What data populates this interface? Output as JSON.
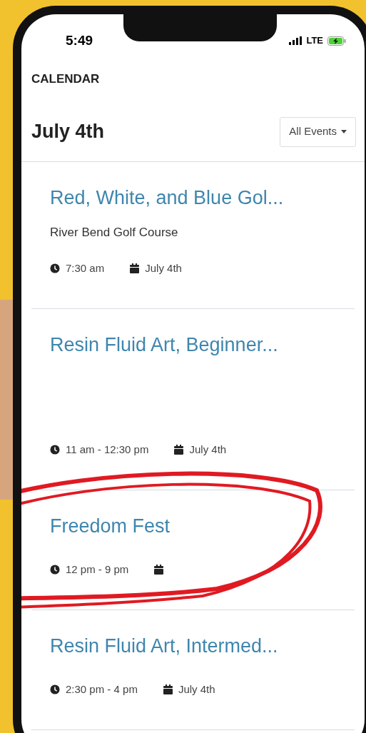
{
  "status_bar": {
    "time": "5:49",
    "network": "LTE"
  },
  "header": {
    "title": "CALENDAR"
  },
  "day": {
    "title": "July 4th",
    "filter": "All Events"
  },
  "events": [
    {
      "title": "Red, White, and Blue Gol...",
      "location": "River Bend Golf Course",
      "time": "7:30 am",
      "date": "July 4th"
    },
    {
      "title": "Resin Fluid Art, Beginner...",
      "time": "11 am - 12:30 pm",
      "date": "July 4th"
    },
    {
      "title": "Freedom Fest",
      "time": "12 pm - 9 pm"
    },
    {
      "title": "Resin Fluid Art, Intermed...",
      "time": "2:30 pm - 4 pm",
      "date": "July 4th"
    }
  ]
}
